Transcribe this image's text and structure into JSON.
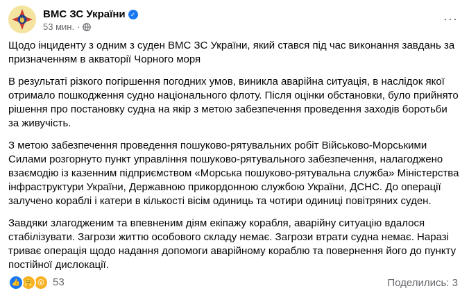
{
  "post": {
    "author": "ВМС ЗС України",
    "verified_icon": "verified-badge-icon",
    "timestamp": "53 мин.",
    "separator": "·",
    "privacy_icon": "globe-icon",
    "more_icon": "more-options-icon",
    "more_label": "···",
    "paragraphs": [
      "Щодо інциденту з одним з суден ВМС ЗС України, який стався під час виконання завдань за призначенням в акваторії Чорного моря",
      "В результаті різкого погіршення погодних умов, виникла аварійна ситуація, в наслідок якої отримало пошкодження судно національного флоту. Після оцінки обстановки, було прийнято рішення про постановку судна на якір з метою забезпечення проведення заходів боротьби за живучість.",
      "З метою забезпечення проведення пошуково-рятувальних робіт Військово-Морськими Силами розгорнуто пункт управління пошуково-рятувального забезпечення, налагоджено взаємодію із казенним підприємством «Морська пошуково-рятувальна служба» Міністерства інфраструктури України, Державною прикордонною службою України, ДСНС. До операції залучено кораблі і катери в кількості вісім одиниць та чотири одиниці повітряних суден.",
      "Завдяки злагодженим та впевненим діям екіпажу корабля, аварійну ситуацію вдалося стабілізувати. Загрози життю особового складу немає. Загрози втрати судна немає. Наразі триває операція щодо надання допомоги аварійному кораблю та повернення його до пункту постійної дислокації."
    ]
  },
  "footer": {
    "reactions": [
      "like-reaction-icon",
      "care-reaction-icon",
      "wow-reaction-icon"
    ],
    "reaction_count": "53",
    "shares": "Поделились: 3"
  },
  "colors": {
    "text": "#050505",
    "secondary": "#65676b",
    "brand_blue": "#1877f2",
    "reaction_yellow": "#f7b125"
  }
}
